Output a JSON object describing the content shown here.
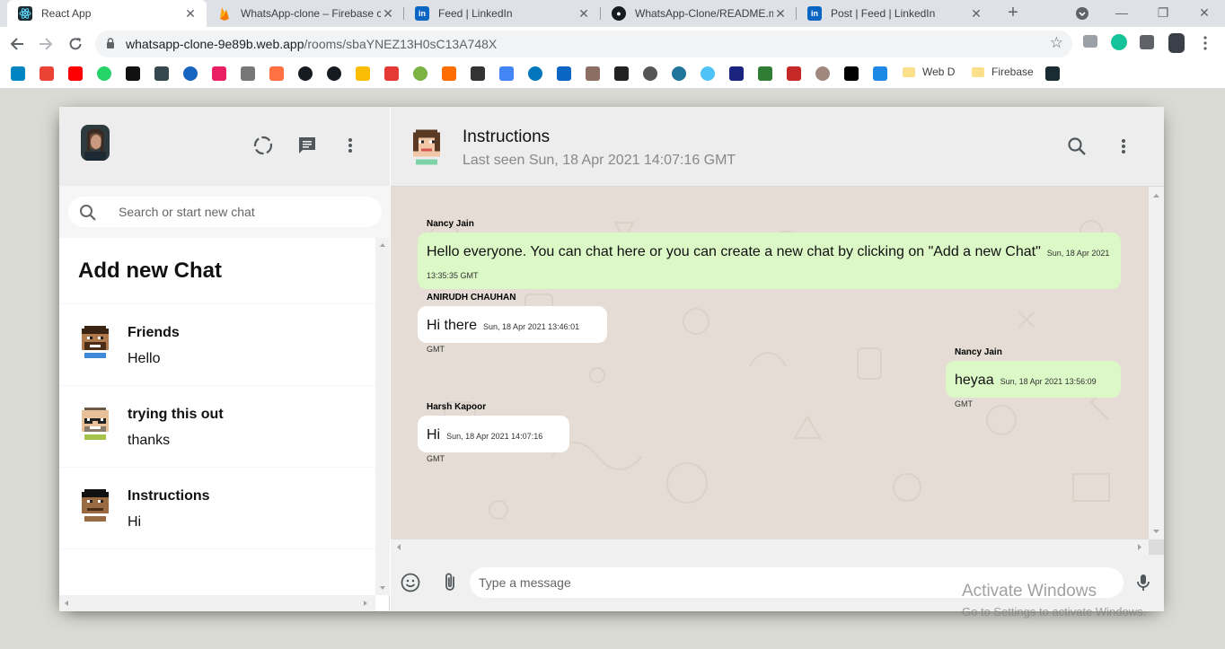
{
  "browser": {
    "tabs": [
      {
        "title": "React App",
        "active": true,
        "icon": "react-icon",
        "color": "#1b2b34"
      },
      {
        "title": "WhatsApp-clone – Firebase c",
        "active": false,
        "icon": "firebase-icon",
        "color": "#f6a61b"
      },
      {
        "title": "Feed | LinkedIn",
        "active": false,
        "icon": "linkedin-icon",
        "color": "#0a66c2"
      },
      {
        "title": "WhatsApp-Clone/README.m",
        "active": false,
        "icon": "github-icon",
        "color": "#161b22"
      },
      {
        "title": "Post | Feed | LinkedIn",
        "active": false,
        "icon": "linkedin-icon",
        "color": "#0a66c2"
      }
    ],
    "new_tab_symbol": "+",
    "url_host": "whatsapp-clone-9e89b.web.app",
    "url_path": "/rooms/sbaYNEZ13H0sC13A748X",
    "bookmarks": [
      {
        "label": "Web D"
      },
      {
        "label": "Firebase"
      }
    ]
  },
  "sidebar": {
    "search_placeholder": "Search or start new chat",
    "add_new_chat_label": "Add new Chat",
    "chats": [
      {
        "name": "Friends",
        "last_message": "Hello"
      },
      {
        "name": "trying this out",
        "last_message": "thanks"
      },
      {
        "name": "Instructions",
        "last_message": "Hi"
      }
    ]
  },
  "chat": {
    "room_name": "Instructions",
    "last_seen": "Last seen Sun, 18 Apr 2021 14:07:16 GMT",
    "messages": [
      {
        "sender": "Nancy Jain",
        "text": "Hello everyone. You can chat here or you can create a new chat by clicking on \"Add a new Chat\"",
        "timestamp": "Sun, 18 Apr 2021 13:35:35 GMT",
        "type": "sent"
      },
      {
        "sender": "ANIRUDH CHAUHAN",
        "text": "Hi there",
        "timestamp": "Sun, 18 Apr 2021 13:46:01 GMT",
        "type": "received"
      },
      {
        "sender": "Nancy Jain",
        "text": "heyaa",
        "timestamp": "Sun, 18 Apr 2021 13:56:09 GMT",
        "type": "sent"
      },
      {
        "sender": "Harsh Kapoor",
        "text": "Hi",
        "timestamp": "Sun, 18 Apr 2021 14:07:16 GMT",
        "type": "received"
      }
    ],
    "input_placeholder": "Type a message"
  },
  "watermark": {
    "line1": "Activate Windows",
    "line2": "Go to Settings to activate Windows."
  },
  "colors": {
    "app_background": "#dadbd3",
    "header_background": "#ededed",
    "chat_background": "#e5ddd5",
    "sent_bubble": "#dcf8c6",
    "received_bubble": "#ffffff"
  }
}
